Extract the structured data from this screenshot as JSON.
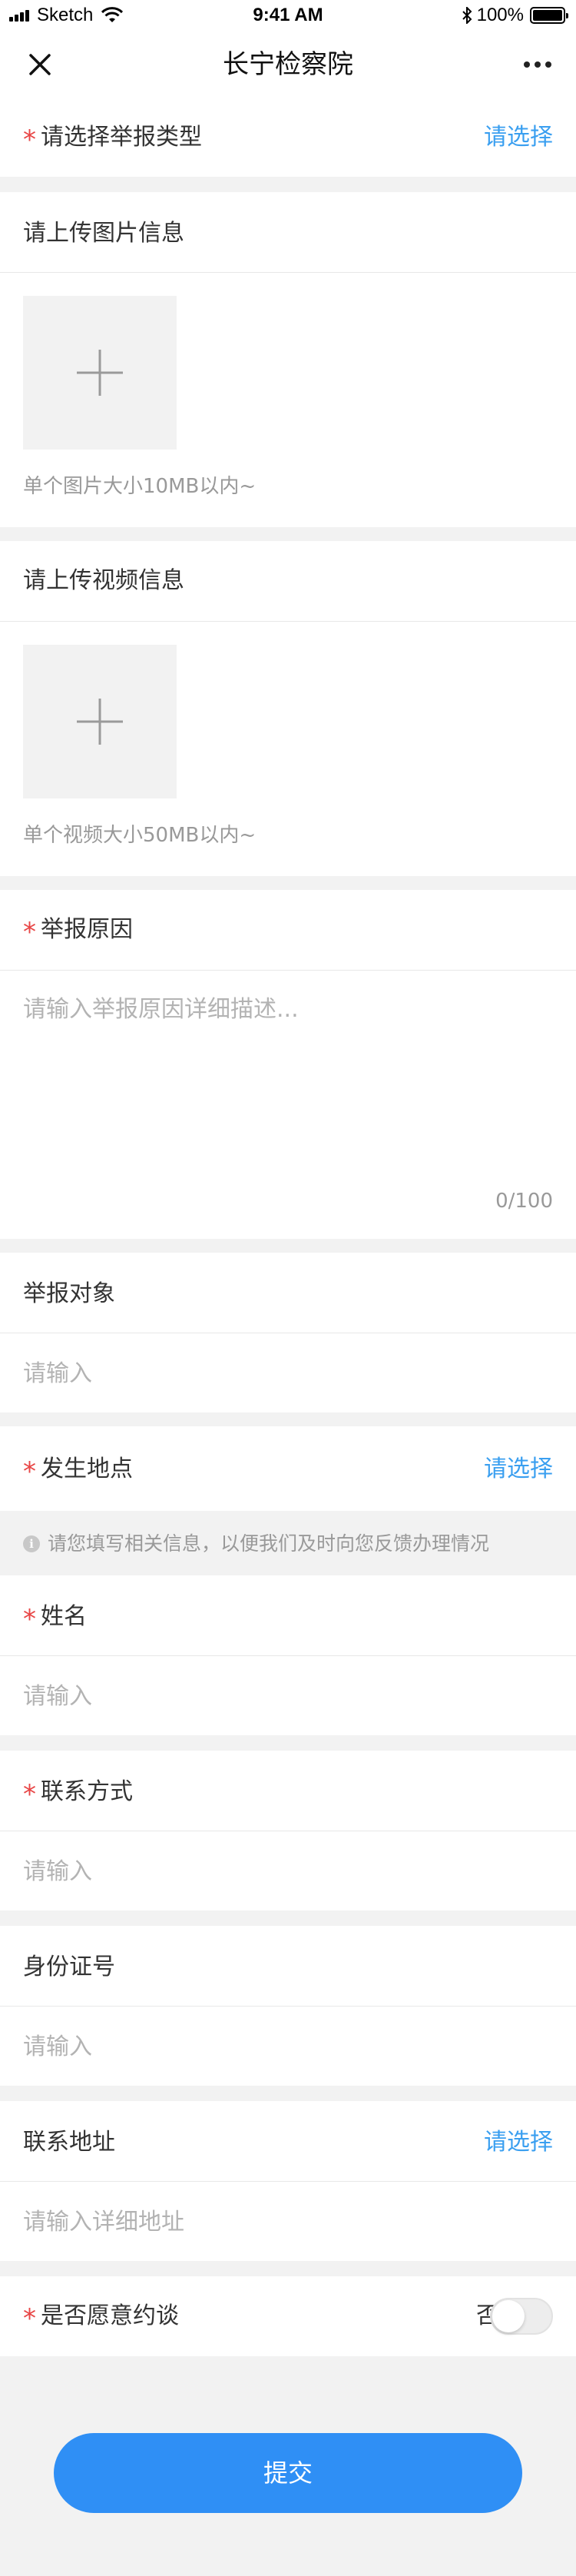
{
  "status_bar": {
    "carrier": "Sketch",
    "time": "9:41 AM",
    "battery": "100%",
    "battery_level": 1.0
  },
  "nav": {
    "title": "长宁检察院",
    "close_icon": "close-icon",
    "more_icon": "more-icon"
  },
  "form": {
    "report_type": {
      "required_mark": "*",
      "label": "请选择举报类型",
      "action": "请选择"
    },
    "image_upload": {
      "label": "请上传图片信息",
      "hint": "单个图片大小10MB以内~",
      "icon": "plus-icon"
    },
    "video_upload": {
      "label": "请上传视频信息",
      "hint": "单个视频大小50MB以内~",
      "icon": "plus-icon"
    },
    "reason": {
      "required_mark": "*",
      "label": "举报原因",
      "placeholder": "请输入举报原因详细描述...",
      "counter": "0/100"
    },
    "target": {
      "label": "举报对象",
      "placeholder": "请输入"
    },
    "location": {
      "required_mark": "*",
      "label": "发生地点",
      "action": "请选择"
    },
    "notice": {
      "icon": "info-icon",
      "text": "请您填写相关信息，以便我们及时向您反馈办理情况"
    },
    "name": {
      "required_mark": "*",
      "label": "姓名",
      "placeholder": "请输入"
    },
    "contact": {
      "required_mark": "*",
      "label": "联系方式",
      "placeholder": "请输入"
    },
    "id_number": {
      "label": "身份证号",
      "placeholder": "请输入"
    },
    "address": {
      "label": "联系地址",
      "action": "请选择",
      "placeholder": "请输入详细地址"
    },
    "interview": {
      "required_mark": "*",
      "label": "是否愿意约谈",
      "value": "否",
      "toggle_on": false
    }
  },
  "submit": {
    "label": "提交"
  },
  "colors": {
    "accent": "#3a9ff0",
    "required": "#e84545",
    "button": "#2f8ff5",
    "background": "#f2f2f2"
  }
}
